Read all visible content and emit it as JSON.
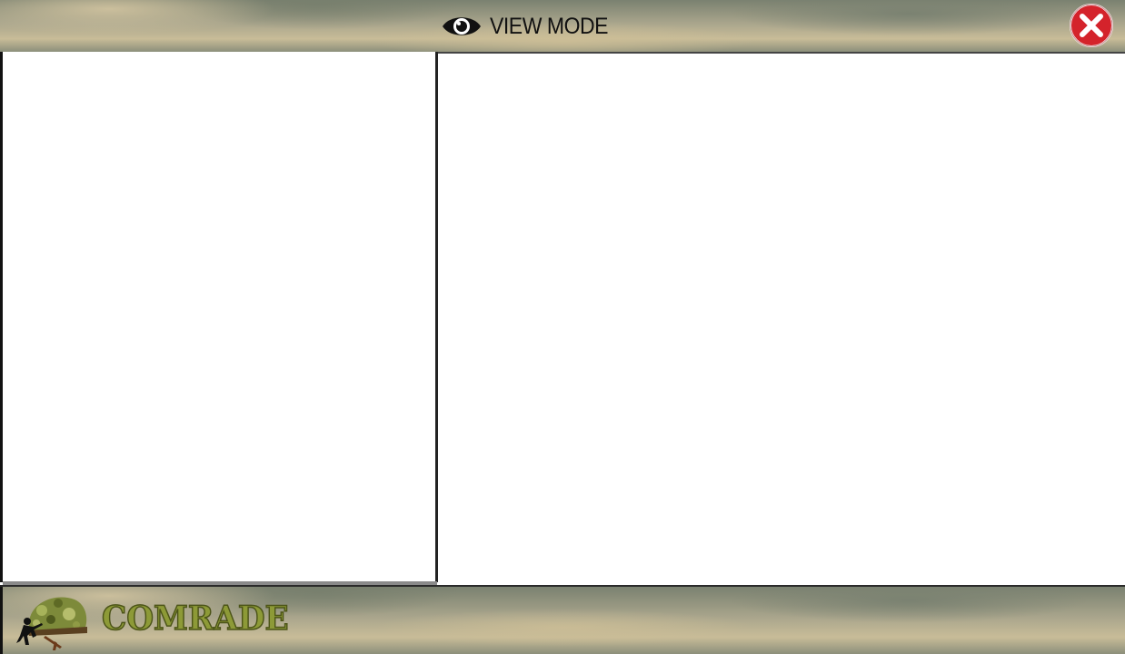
{
  "header": {
    "title": "VIEW MODE",
    "title_icon": "eye-icon",
    "close_icon": "close-icon"
  },
  "footer": {
    "brand_name": "COMRADE",
    "logo_icon": "soldier-helmet-logo"
  },
  "colors": {
    "close_button": "#d4232b",
    "brand_text": "#8d9a37",
    "panel_background": "#ffffff",
    "bar_sand": "#c8bc98",
    "bar_olive": "#7a8170"
  }
}
